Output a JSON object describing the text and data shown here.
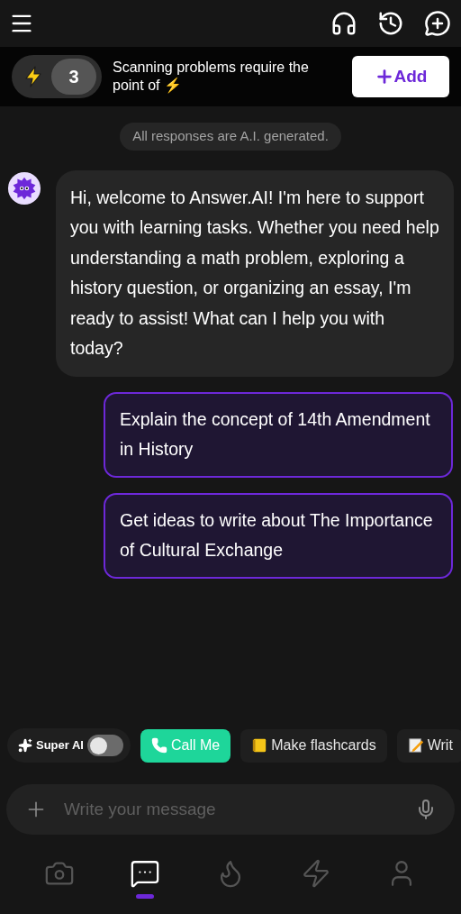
{
  "points_banner": {
    "count": "3",
    "message": "Scanning problems require the point of ⚡",
    "add_button": "Add"
  },
  "disclaimer": "All responses are A.I. generated.",
  "messages": [
    {
      "kind": "bot",
      "text": "Hi, welcome to Answer.AI! I'm here to support you with learning tasks. Whether you need help understanding a math problem, exploring a history question, or organizing an essay, I'm ready to assist! What can I help you with today?"
    },
    {
      "kind": "suggestion",
      "text": "Explain the concept of 14th Amendment in History"
    },
    {
      "kind": "suggestion",
      "text": "Get ideas to write about The Importance of Cultural Exchange"
    }
  ],
  "chips": [
    {
      "kind": "toggle",
      "label": "Super AI",
      "on": false
    },
    {
      "kind": "call",
      "label": "Call Me"
    },
    {
      "kind": "notebook",
      "label": "Make flashcards"
    },
    {
      "kind": "memo",
      "label": "Writ"
    }
  ],
  "composer": {
    "placeholder": "Write your message"
  },
  "nav": [
    {
      "kind": "camera",
      "selected": false
    },
    {
      "kind": "chat",
      "selected": true
    },
    {
      "kind": "flame",
      "selected": false
    },
    {
      "kind": "bolt",
      "selected": false
    },
    {
      "kind": "person",
      "selected": false
    }
  ]
}
